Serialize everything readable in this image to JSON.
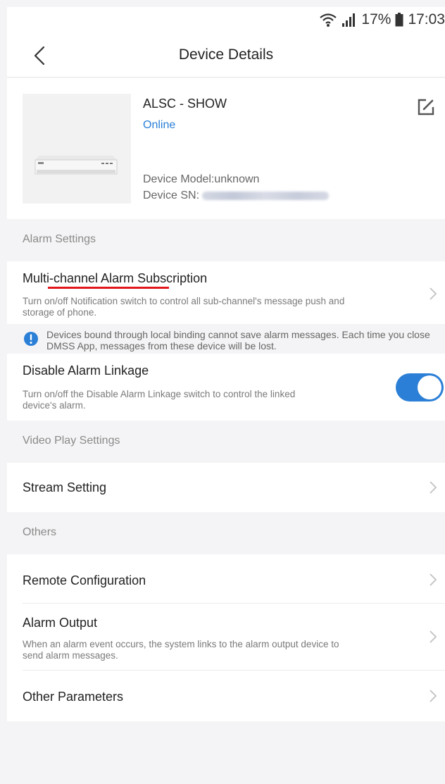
{
  "status_bar": {
    "battery": "17%",
    "time": "17:03"
  },
  "nav": {
    "title": "Device Details"
  },
  "device": {
    "name": "ALSC - SHOW",
    "status": "Online",
    "model": "Device Model:unknown",
    "sn_label": "Device SN:"
  },
  "sections": {
    "alarm": "Alarm Settings",
    "video": "Video Play Settings",
    "others": "Others"
  },
  "rows": {
    "multi_channel": {
      "title": "Multi-channel Alarm Subscription",
      "desc": "Turn on/off Notification switch to control all sub-channel's message push and storage of phone."
    },
    "notice": "Devices bound through local binding cannot save alarm messages. Each time you close DMSS App, messages from these device will be lost.",
    "disable_linkage": {
      "title": "Disable Alarm Linkage",
      "desc": "Turn on/off the Disable Alarm Linkage switch to control the linked device's alarm.",
      "enabled": true
    },
    "stream_setting": {
      "title": "Stream Setting"
    },
    "remote_config": {
      "title": "Remote Configuration"
    },
    "alarm_output": {
      "title": "Alarm Output",
      "desc": "When an alarm event occurs, the system links to the alarm output device to send alarm messages."
    },
    "other_params": {
      "title": "Other Parameters"
    }
  },
  "colors": {
    "accent": "#2b7fd6",
    "annotation": "#e3161b"
  }
}
